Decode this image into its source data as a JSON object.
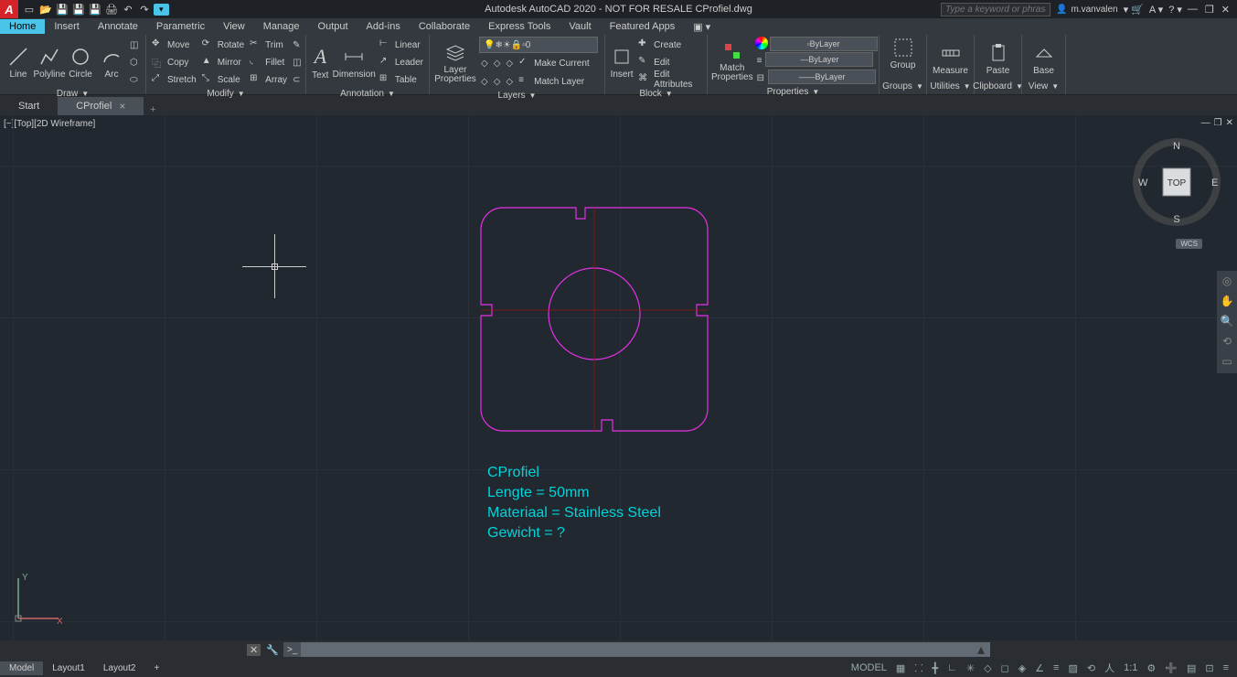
{
  "title": "Autodesk AutoCAD 2020 - NOT FOR RESALE    CProfiel.dwg",
  "search_placeholder": "Type a keyword or phrase",
  "user": "m.vanvalen",
  "menus": [
    "Home",
    "Insert",
    "Annotate",
    "Parametric",
    "View",
    "Manage",
    "Output",
    "Add-ins",
    "Collaborate",
    "Express Tools",
    "Vault",
    "Featured Apps"
  ],
  "draw": {
    "line": "Line",
    "polyline": "Polyline",
    "circle": "Circle",
    "arc": "Arc",
    "title": "Draw"
  },
  "modify": {
    "move": "Move",
    "rotate": "Rotate",
    "trim": "Trim",
    "copy": "Copy",
    "mirror": "Mirror",
    "fillet": "Fillet",
    "stretch": "Stretch",
    "scale": "Scale",
    "array": "Array",
    "title": "Modify"
  },
  "annotation": {
    "text": "Text",
    "dimension": "Dimension",
    "linear": "Linear",
    "leader": "Leader",
    "table": "Table",
    "title": "Annotation"
  },
  "layers": {
    "btn": "Layer\nProperties",
    "match": "Match Layer",
    "make": "Make Current",
    "dd": "0",
    "title": "Layers"
  },
  "block": {
    "insert": "Insert",
    "create": "Create",
    "edit": "Edit",
    "attrs": "Edit Attributes",
    "title": "Block"
  },
  "props": {
    "match": "Match\nProperties",
    "bylayer": "ByLayer",
    "title": "Properties"
  },
  "groups": {
    "btn": "Group",
    "title": "Groups"
  },
  "utils": {
    "btn": "Measure",
    "title": "Utilities"
  },
  "clip": {
    "btn": "Paste",
    "title": "Clipboard"
  },
  "view": {
    "btn": "Base",
    "title": "View"
  },
  "filetabs": {
    "start": "Start",
    "file": "CProfiel"
  },
  "viewlabel": "[−][Top][2D Wireframe]",
  "part_text": [
    "CProfiel",
    "Lengte = 50mm",
    "Materiaal = Stainless Steel",
    "Gewicht = ?"
  ],
  "viewcube": {
    "top": "TOP",
    "n": "N",
    "s": "S",
    "e": "E",
    "w": "W"
  },
  "wcs": "WCS",
  "cmd_prompt": ">_",
  "layouts": [
    "Model",
    "Layout1",
    "Layout2"
  ],
  "model_btn": "MODEL",
  "scale": "1:1"
}
